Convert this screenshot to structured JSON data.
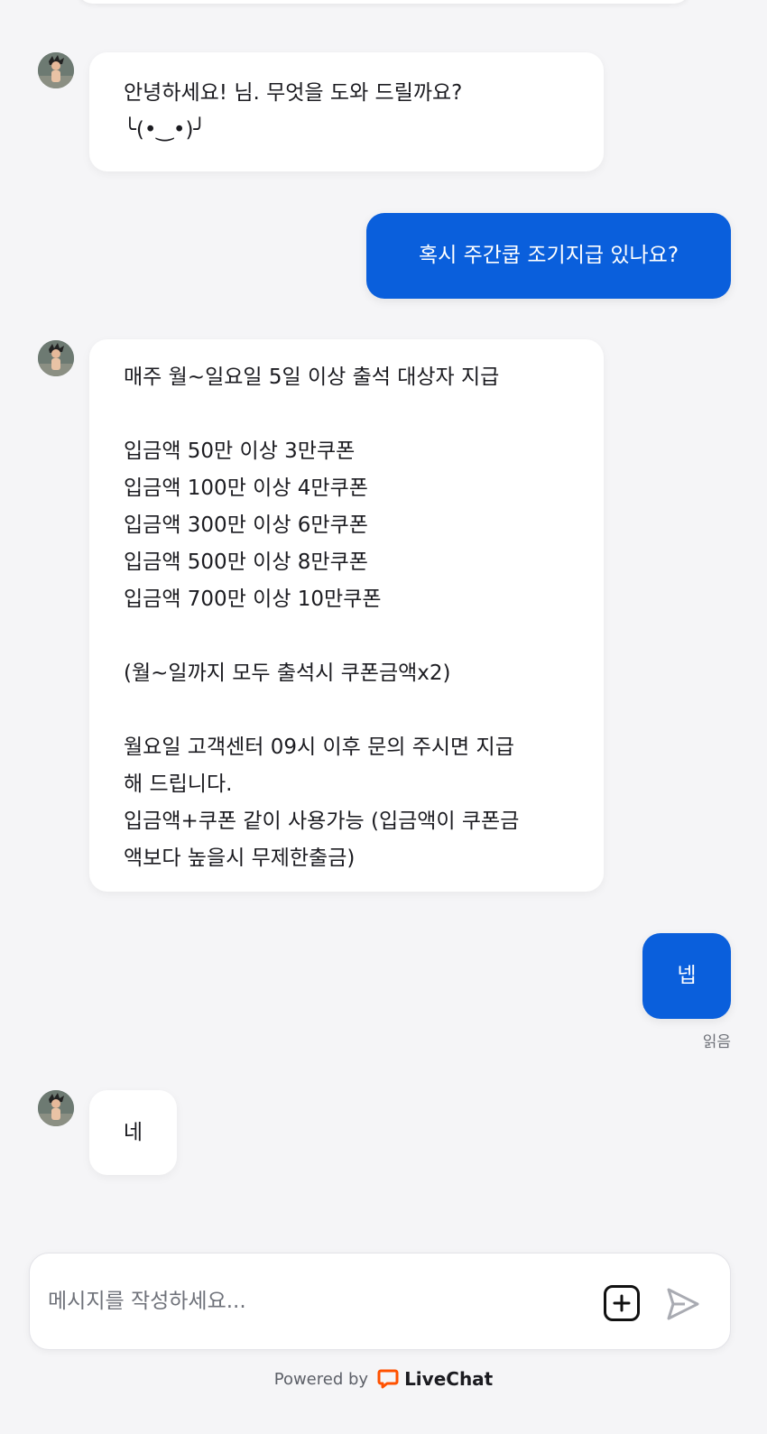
{
  "messages": [
    {
      "from": "agent",
      "text": "안녕하세요! 님. 무엇을 도와 드릴까요?\n╰(•‿•)╯"
    },
    {
      "from": "user",
      "text": "혹시 주간쿱 조기지급 있나요?"
    },
    {
      "from": "agent",
      "text": "매주 월~일요일 5일 이상 출석 대상자 지급\n\n입금액 50만 이상 3만쿠폰\n입금액 100만 이상 4만쿠폰\n입금액 300만 이상 6만쿠폰\n입금액 500만 이상 8만쿠폰\n입금액 700만 이상 10만쿠폰\n\n(월~일까지 모두 출석시 쿠폰금액x2)\n\n월요일 고객센터 09시 이후 문의 주시면 지급\n해 드립니다.\n입금액+쿠폰 같이 사용가능 (입금액이 쿠폰금\n액보다 높을시 무제한출금)"
    },
    {
      "from": "user",
      "text": "넵"
    },
    {
      "from": "agent",
      "text": "네"
    }
  ],
  "read_status": "읽음",
  "composer": {
    "placeholder": "메시지를 작성하세요..."
  },
  "footer": {
    "powered_by": "Powered by",
    "brand": "LiveChat"
  },
  "colors": {
    "user_bubble": "#0a5fdc",
    "brand_accent": "#ff5100",
    "background": "#f5f5f7"
  }
}
